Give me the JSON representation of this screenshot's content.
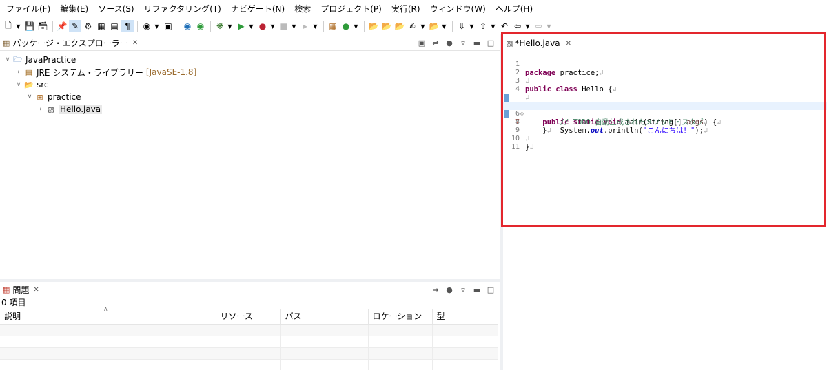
{
  "menu": [
    "ファイル(F)",
    "編集(E)",
    "ソース(S)",
    "リファクタリング(T)",
    "ナビゲート(N)",
    "検索",
    "プロジェクト(P)",
    "実行(R)",
    "ウィンドウ(W)",
    "ヘルプ(H)"
  ],
  "explorer": {
    "tab_title": "パッケージ・エクスプローラー",
    "tree": [
      {
        "label": "JavaPractice",
        "suffix": ""
      },
      {
        "label": "JRE システム・ライブラリー",
        "suffix": "[JavaSE-1.8]"
      },
      {
        "label": "src",
        "suffix": ""
      },
      {
        "label": "practice",
        "suffix": ""
      },
      {
        "label": "Hello.java",
        "suffix": ""
      }
    ]
  },
  "problems": {
    "tab_title": "問題",
    "item_count": "0 項目",
    "columns": [
      "説明",
      "リソース",
      "パス",
      "ロケーション",
      "型"
    ]
  },
  "editor": {
    "tab_title": "*Hello.java",
    "lines": [
      "1",
      "2",
      "3",
      "4",
      "5",
      "6",
      "7",
      "8",
      "9",
      "10",
      "11"
    ],
    "code": {
      "package_kw": "package",
      "package_name": " practice;",
      "public_kw": "public",
      "class_kw": "class",
      "class_name": " Hello {",
      "static_kw": "static",
      "void_kw": "void",
      "main_sig": " main(String[] ",
      "args": "args",
      "main_end": ") {",
      "comment": "// TODO 自動生成されたメソッド・スタブ",
      "sysout_pre": "System.",
      "out_field": "out",
      "println": ".println(",
      "string_lit": "\"こんにちは！\"",
      "stmt_end": ");",
      "close_brace": "}"
    }
  },
  "colors": {
    "highlight_frame": "#e3262d",
    "keyword": "#7f0055",
    "comment": "#3f7f5f",
    "string": "#2a00ff"
  }
}
